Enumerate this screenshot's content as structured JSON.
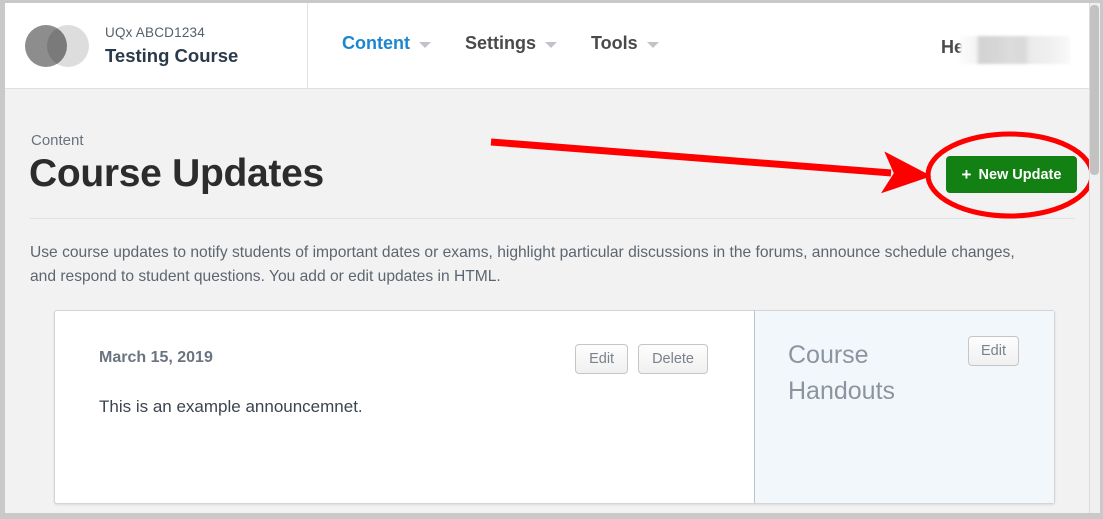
{
  "header": {
    "logo_icon": "two-overlapping-circles-logo",
    "course_code": "UQx  ABCD1234",
    "course_name": "Testing Course",
    "nav": [
      {
        "label": "Content",
        "active": true,
        "caret": "chevron-down-icon"
      },
      {
        "label": "Settings",
        "active": false,
        "caret": "chevron-down-icon"
      },
      {
        "label": "Tools",
        "active": false,
        "caret": "chevron-down-icon"
      }
    ],
    "help_label": "Help",
    "redacted_user_area": ""
  },
  "page": {
    "breadcrumb": "Content",
    "title": "Course Updates",
    "new_update_label": "New Update",
    "new_update_plus": "+",
    "description": "Use course updates to notify students of important dates or exams, highlight particular discussions in the forums, announce schedule changes, and respond to student questions. You add or edit updates in HTML."
  },
  "update_card": {
    "date": "March 15, 2019",
    "body": "This is an example announcemnet.",
    "edit_label": "Edit",
    "delete_label": "Delete"
  },
  "handouts_panel": {
    "title": "Course Handouts",
    "edit_label": "Edit"
  },
  "annotations": {
    "arrow": "red-arrow-pointing-to-new-update-button",
    "ellipse": "red-ellipse-highlighting-new-update-button"
  },
  "colors": {
    "accent_blue": "#1c87d0",
    "button_green": "#128012",
    "annotation_red": "#ff0000",
    "panel_blue": "#f2f7fb",
    "body_bg": "#f2f2f2"
  },
  "scrollbar": {
    "name": "vertical-scrollbar"
  }
}
